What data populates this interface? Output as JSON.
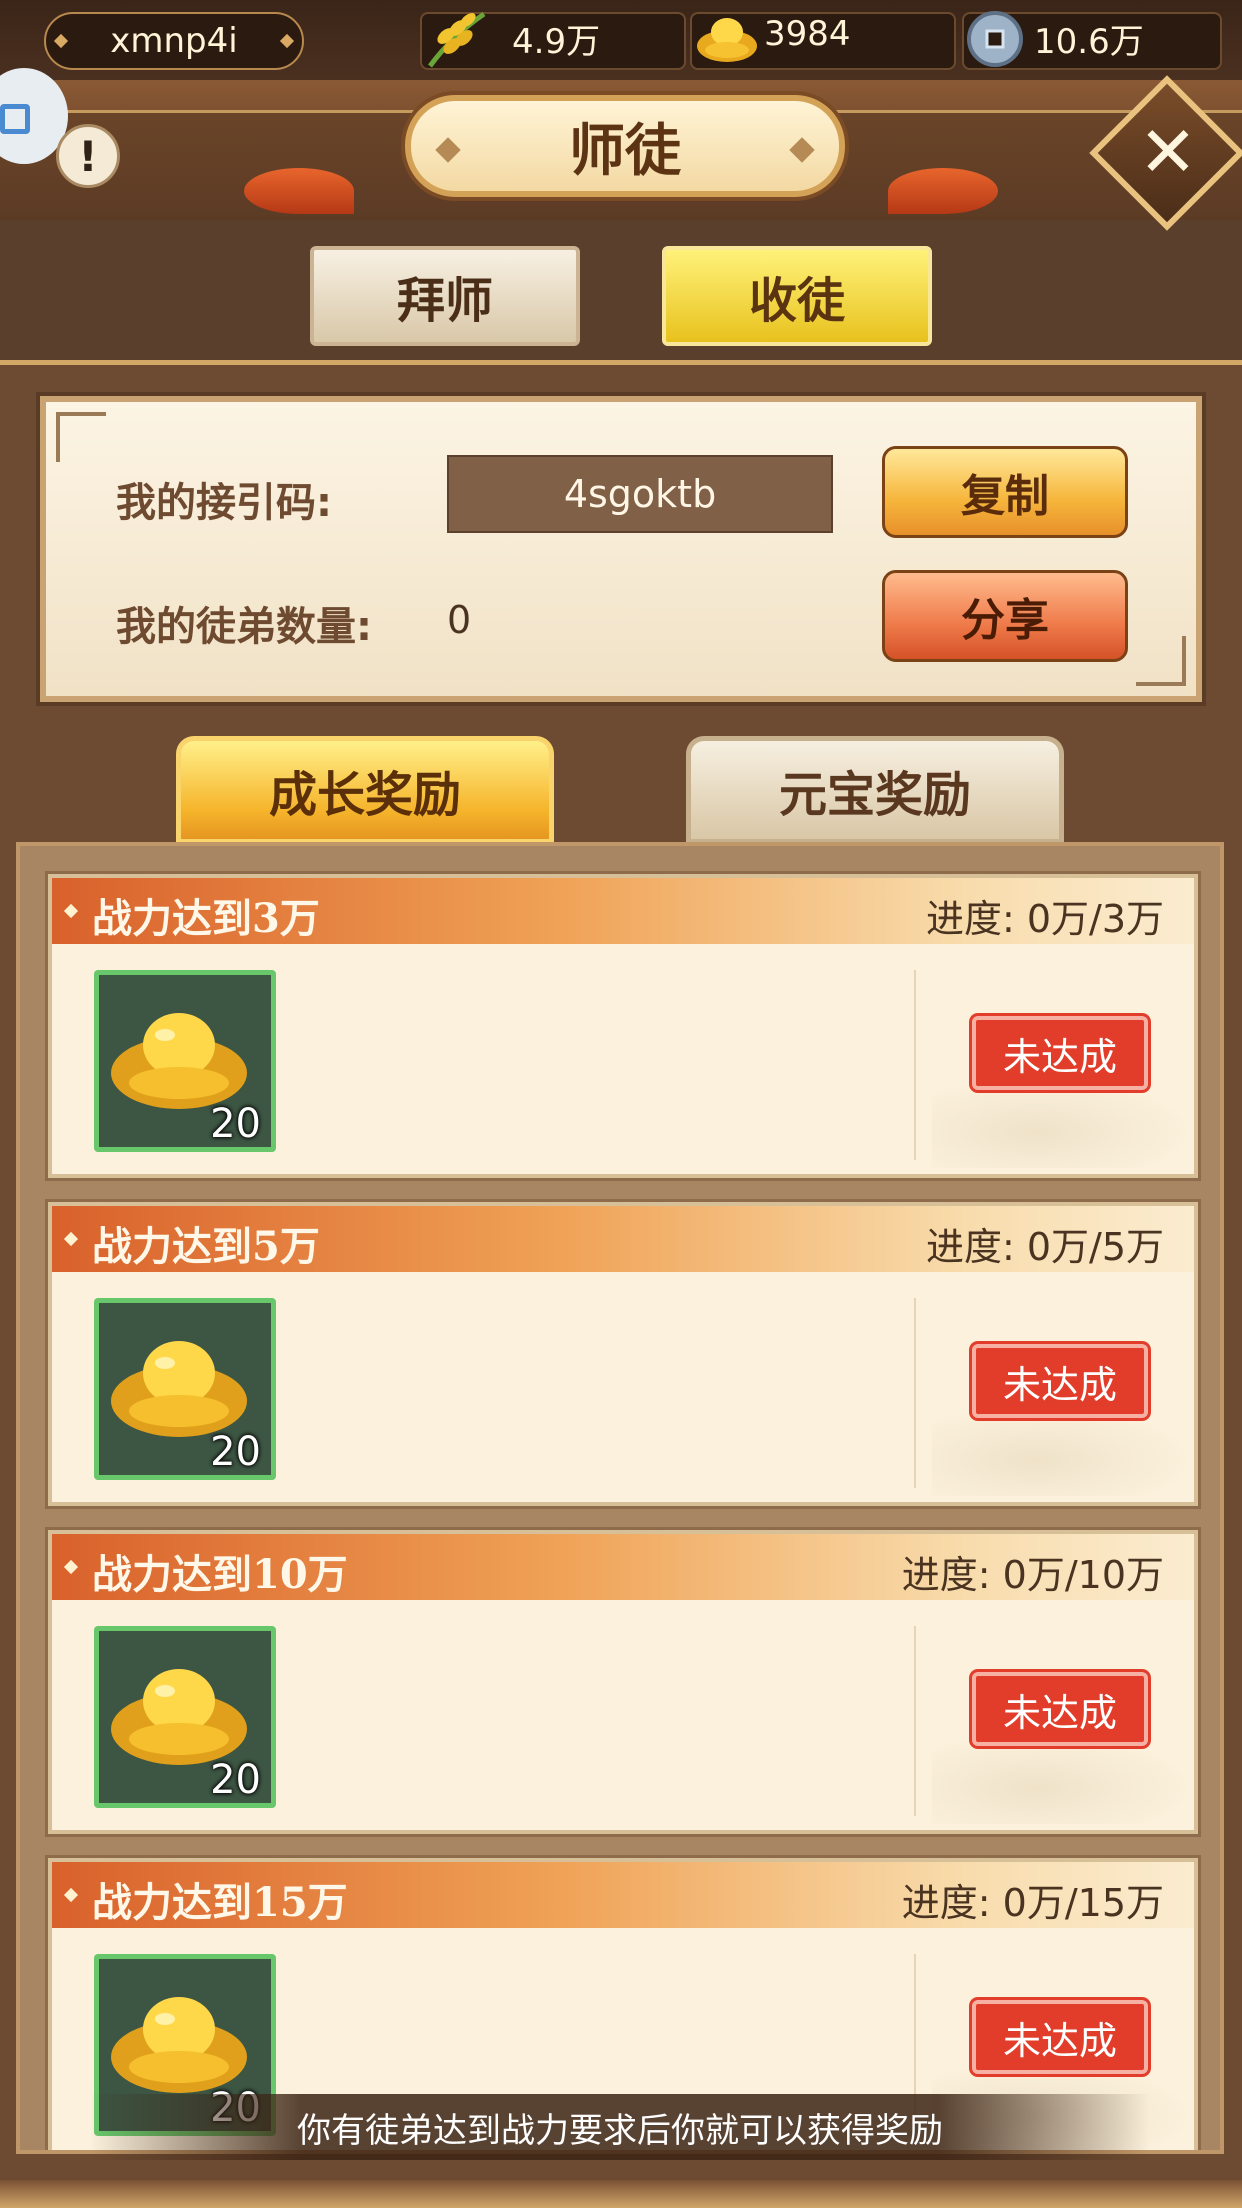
{
  "status_bar": {
    "username": "xmnp4i",
    "grain": "4.9万",
    "gold_ingot": "3984",
    "copper_coin": "10.6万"
  },
  "header": {
    "title": "师徒",
    "close_label": "✕"
  },
  "main_tabs": [
    {
      "label": "拜师",
      "active": false
    },
    {
      "label": "收徒",
      "active": true
    }
  ],
  "invite_panel": {
    "code_label": "我的接引码:",
    "code_value": "4sgoktb",
    "copy_label": "复制",
    "disciple_count_label": "我的徒弟数量:",
    "disciple_count_value": "0",
    "share_label": "分享"
  },
  "reward_tabs": [
    {
      "label": "成长奖励",
      "active": true
    },
    {
      "label": "元宝奖励",
      "active": false
    }
  ],
  "rewards": [
    {
      "title": "战力达到3万",
      "progress": "进度: 0万/3万",
      "item": "gold-ingot",
      "quantity": "20",
      "status": "未达成"
    },
    {
      "title": "战力达到5万",
      "progress": "进度: 0万/5万",
      "item": "gold-ingot",
      "quantity": "20",
      "status": "未达成"
    },
    {
      "title": "战力达到10万",
      "progress": "进度: 0万/10万",
      "item": "gold-ingot",
      "quantity": "20",
      "status": "未达成"
    },
    {
      "title": "战力达到15万",
      "progress": "进度: 0万/15万",
      "item": "gold-ingot",
      "quantity": "20",
      "status": "未达成"
    }
  ],
  "toast": "你有徒弟达到战力要求后你就可以获得奖励",
  "colors": {
    "accent_gold": "#f6b53b",
    "stamp_red": "#e23d2a",
    "item_border_green": "#69c76b"
  }
}
